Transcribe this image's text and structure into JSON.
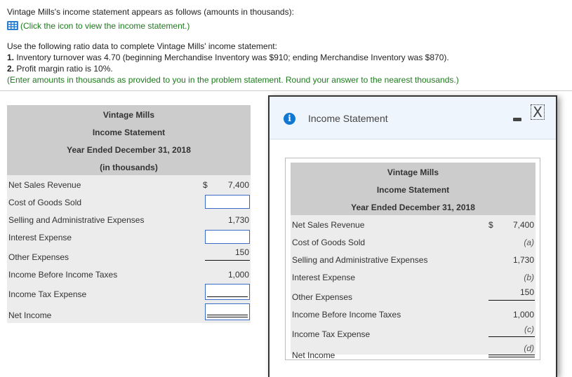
{
  "question": {
    "intro": "Vintage Mills's income statement appears as follows (amounts in thousands):",
    "icon_link": "(Click the icon to view the income statement.)",
    "instruction": "Use the following ratio data to complete Vintage Mills' income statement:",
    "items": [
      {
        "num": "1.",
        "text": " Inventory turnover was 4.70 (beginning Merchandise Inventory was $910; ending Merchandise Inventory was $870)."
      },
      {
        "num": "2.",
        "text": " Profit margin ratio is 10%."
      }
    ],
    "note": "(Enter amounts in thousands as provided to you in the problem statement. Round your answer to the nearest thousands.)"
  },
  "answer_table": {
    "company": "Vintage Mills",
    "statement": "Income Statement",
    "period": "Year Ended December 31, 2018",
    "units": "(in thousands)",
    "rows": [
      {
        "label": "Net Sales Revenue",
        "dollar": "$",
        "value": "7,400"
      },
      {
        "label": "Cost of Goods Sold",
        "value": ""
      },
      {
        "label": "Selling and Administrative Expenses",
        "value": "1,730"
      },
      {
        "label": "Interest Expense",
        "value": ""
      },
      {
        "label": "Other Expenses",
        "value": "150"
      },
      {
        "label": "Income Before Income Taxes",
        "value": "1,000"
      },
      {
        "label": "Income Tax Expense",
        "value": ""
      },
      {
        "label": "Net Income",
        "value": ""
      }
    ]
  },
  "modal": {
    "title": "Income Statement",
    "minimize_symbol": "–",
    "close_symbol": "X",
    "company": "Vintage Mills",
    "statement": "Income Statement",
    "period": "Year Ended December 31, 2018",
    "rows": [
      {
        "label": "Net Sales Revenue",
        "dollar": "$",
        "value": "7,400"
      },
      {
        "label": "Cost of Goods Sold",
        "value": "(a)"
      },
      {
        "label": "Selling and Administrative Expenses",
        "value": "1,730"
      },
      {
        "label": "Interest Expense",
        "value": "(b)"
      },
      {
        "label": "Other Expenses",
        "value": "150"
      },
      {
        "label": "Income Before Income Taxes",
        "value": "1,000"
      },
      {
        "label": "Income Tax Expense",
        "value": "(c)"
      },
      {
        "label": "Net Income",
        "value": "(d)"
      }
    ]
  }
}
